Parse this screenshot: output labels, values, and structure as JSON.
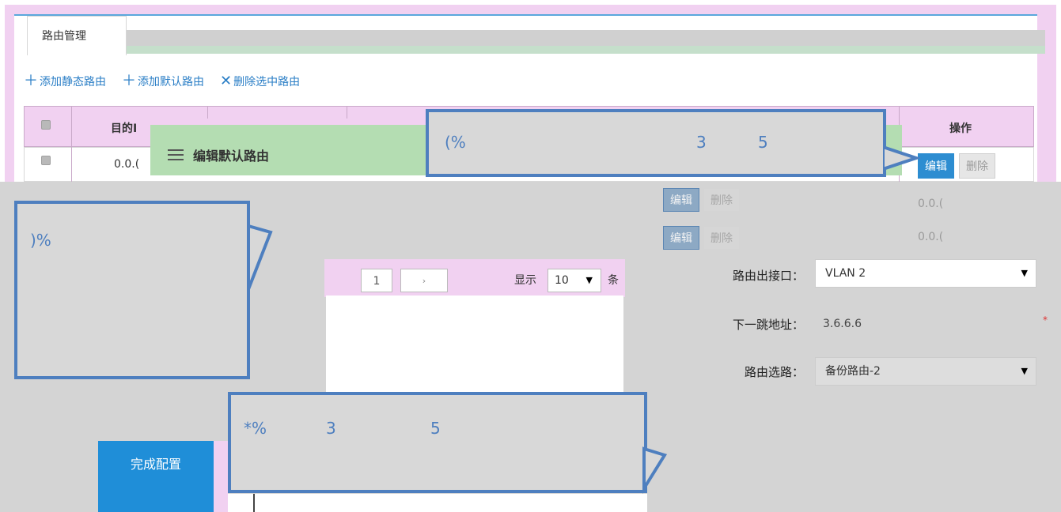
{
  "tab": {
    "label": "路由管理"
  },
  "toolbar": {
    "add_static": "添加静态路由",
    "add_default": "添加默认路由",
    "delete_selected": "删除选中路由"
  },
  "table": {
    "header_dest": "目的I",
    "header_ops": "操作",
    "row1_dest": "0.0.(",
    "edit_label": "编辑",
    "delete_label": "删除"
  },
  "modal": {
    "title": "编辑默认路由"
  },
  "faded": {
    "edit_label": "编辑",
    "delete_label": "删除",
    "val1": "0.0.(",
    "val2": "0.0.("
  },
  "pagination": {
    "current_page": "1",
    "show_label": "显示",
    "page_size": "10",
    "unit": "条"
  },
  "form": {
    "iface_label": "路由出接口：",
    "iface_value": "VLAN 2",
    "next_hop_label": "下一跳地址：",
    "next_hop_value": "3.6.6.6",
    "required_mark": "*",
    "route_select_label": "路由选路：",
    "route_select_value": "备份路由-2"
  },
  "finish_button": "完成配置",
  "callouts": {
    "c1": {
      "t1": "(%",
      "t2": "3",
      "t3": "5"
    },
    "c2": {
      "t1": ")%"
    },
    "c3": {
      "t1": "*%",
      "t2": "3",
      "t3": "5"
    }
  },
  "colors": {
    "accent": "#2d8dd1",
    "callout": "#4e7fbf",
    "frame_pink": "#f1d1f1",
    "modal_green": "#b4ddb2"
  },
  "icons": {
    "add": "plus-icon",
    "delete": "x-icon",
    "menu": "hamburger-icon",
    "dropdown": "caret-down-icon"
  }
}
